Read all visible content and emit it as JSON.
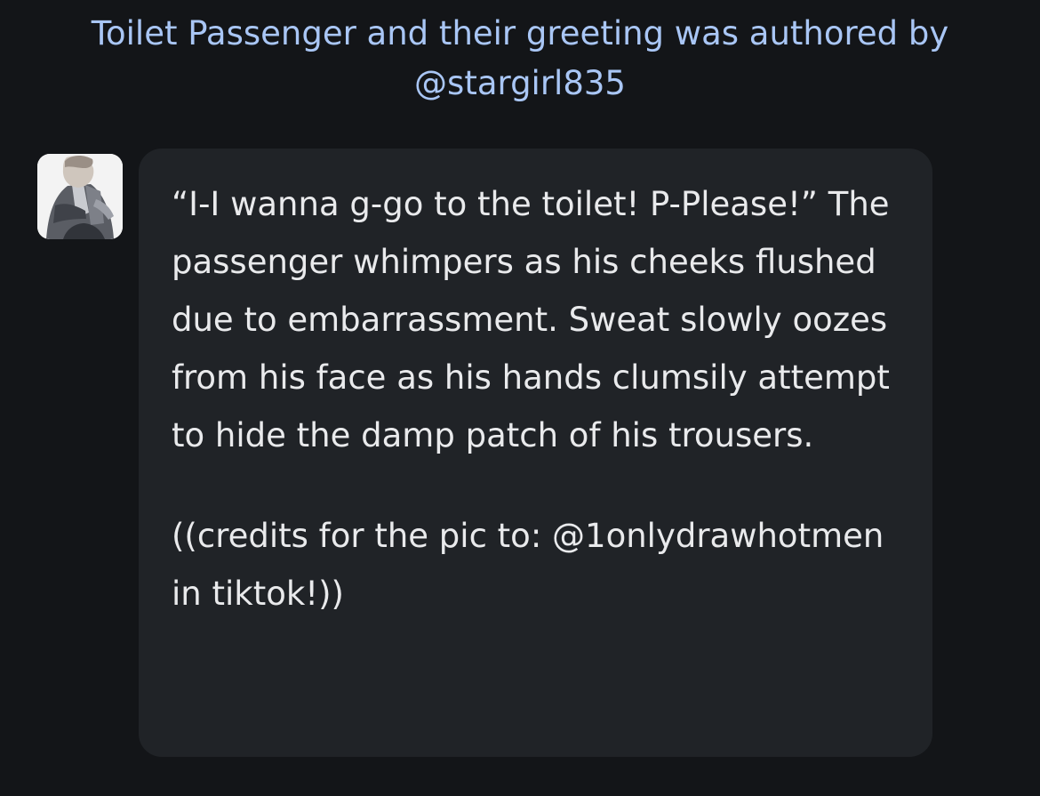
{
  "header": {
    "author_line_1": "Toilet Passenger and their greeting was authored by",
    "author_line_2": "@stargirl835",
    "link_color": "#a9c6f5"
  },
  "message": {
    "avatar_icon": "character-portrait-icon",
    "paragraphs": [
      "“I-I wanna g-go to the toilet! P-Please!” The passenger whimpers as his cheeks flushed due to embarrassment. Sweat slowly oozes from his face as his hands clumsily attempt to hide the damp patch of his trousers.",
      "((credits for the pic to: @1onlydrawhotmen in tiktok!))"
    ],
    "bubble_color": "#202327",
    "text_color": "#e9eaec"
  },
  "theme": {
    "background": "#131518"
  }
}
